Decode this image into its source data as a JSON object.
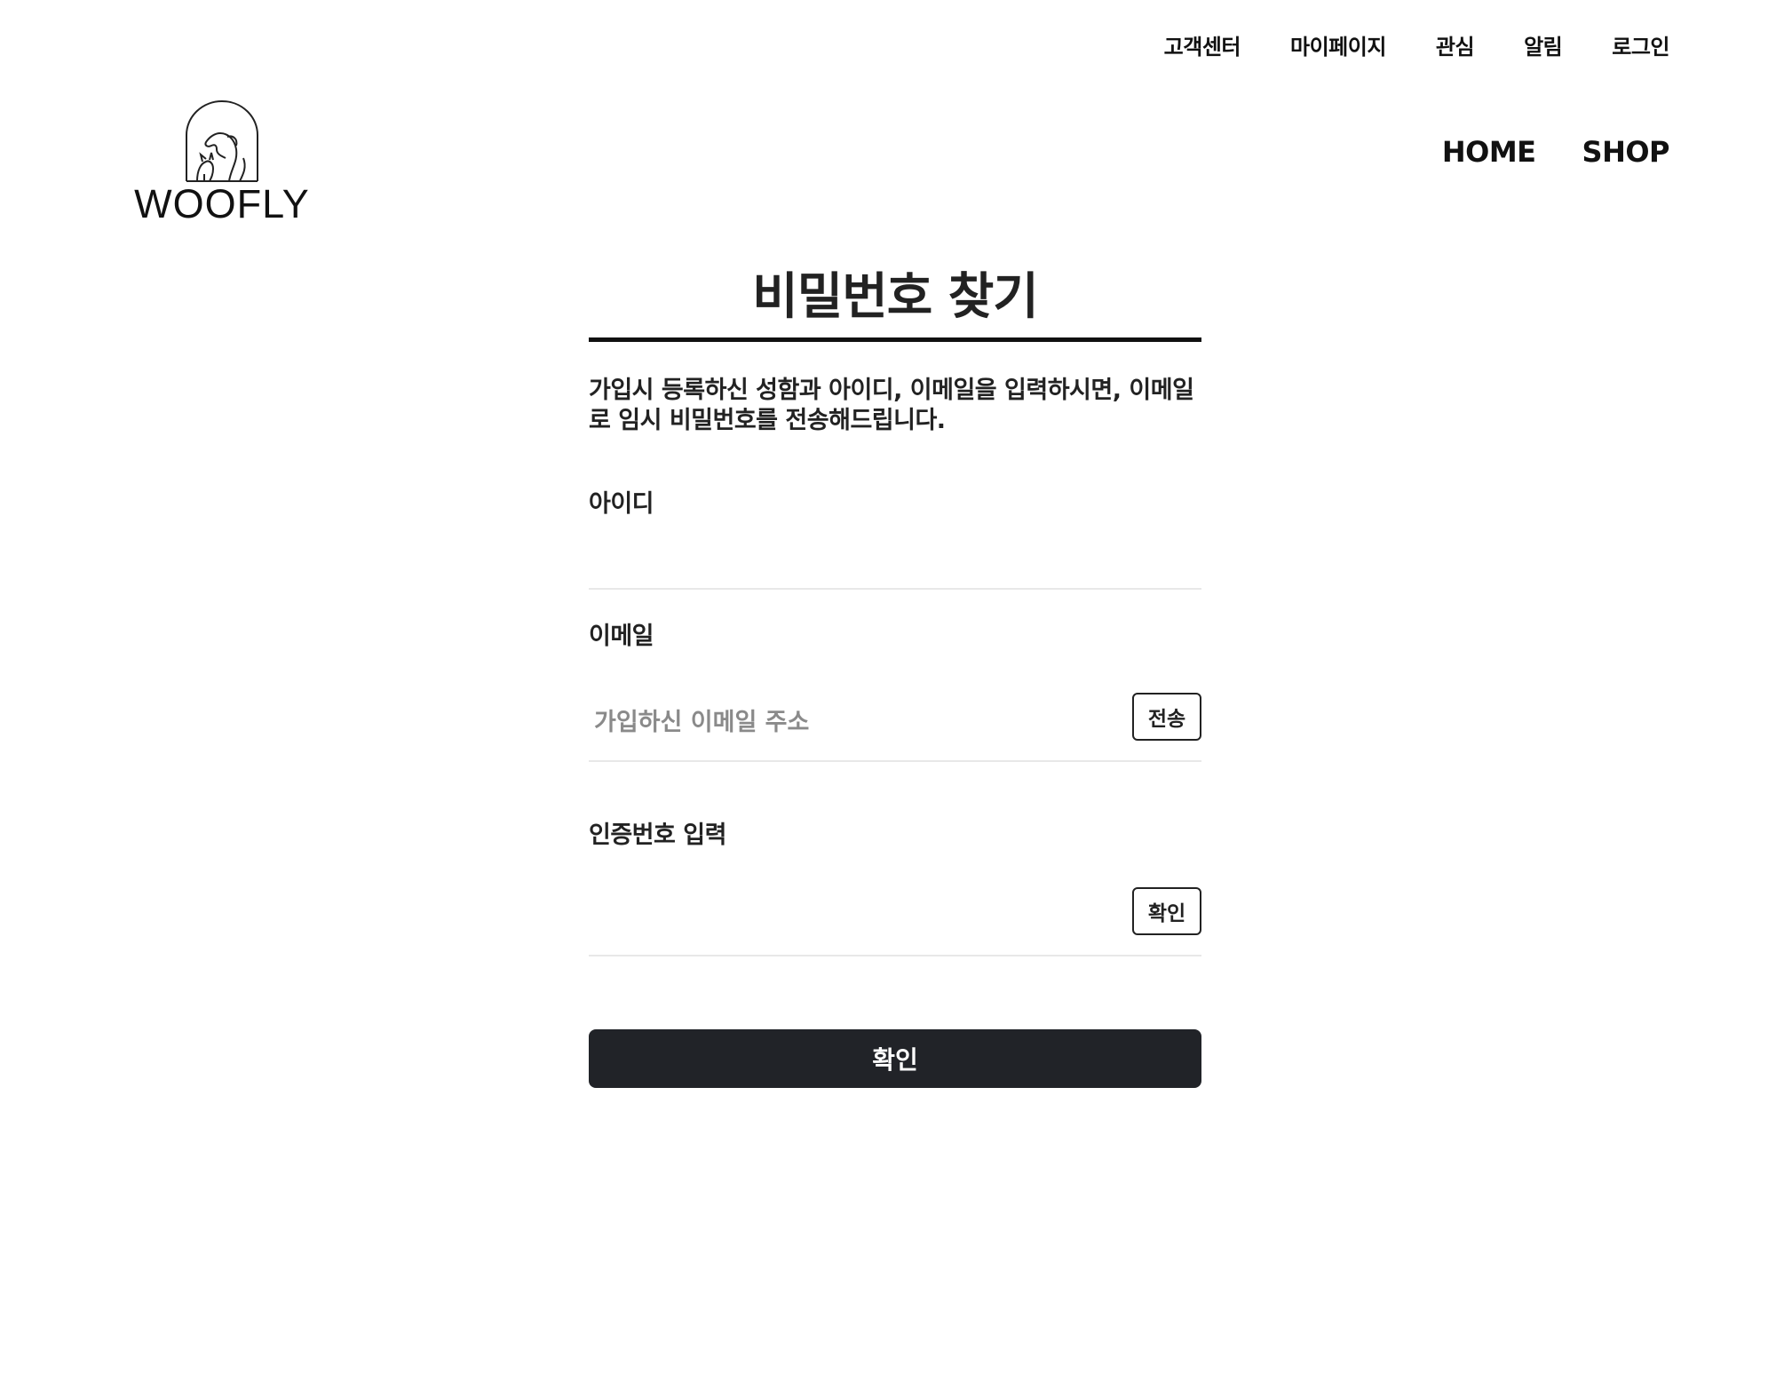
{
  "util_nav": {
    "items": [
      {
        "label": "고객센터"
      },
      {
        "label": "마이페이지"
      },
      {
        "label": "관심"
      },
      {
        "label": "알림"
      },
      {
        "label": "로그인"
      }
    ]
  },
  "logo": {
    "text": "WOOFLY",
    "icon": "dog-cat-arch-icon"
  },
  "main_nav": {
    "items": [
      {
        "label": "HOME"
      },
      {
        "label": "SHOP"
      }
    ]
  },
  "page": {
    "title": "비밀번호 찾기",
    "description": "가입시 등록하신 성함과 아이디, 이메일을 입력하시면, 이메일로 임시 비밀번호를 전송해드립니다.",
    "fields": {
      "id": {
        "label": "아이디",
        "value": "",
        "placeholder": ""
      },
      "email": {
        "label": "이메일",
        "value": "",
        "placeholder": "가입하신 이메일 주소",
        "button_label": "전송"
      },
      "code": {
        "label": "인증번호 입력",
        "value": "",
        "placeholder": "",
        "button_label": "확인"
      }
    },
    "submit_label": "확인"
  },
  "colors": {
    "text": "#111111",
    "submit_bg": "#212328",
    "divider": "#e8e8e8",
    "placeholder": "#8a8a8a"
  }
}
